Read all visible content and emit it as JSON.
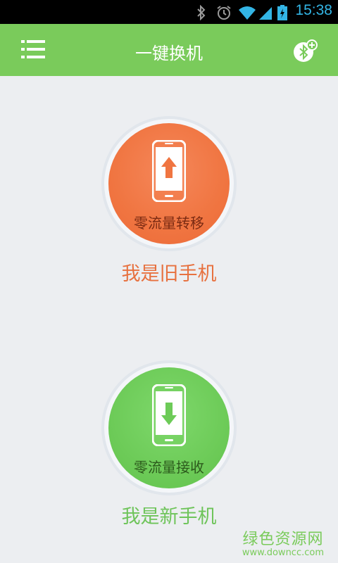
{
  "status_bar": {
    "time": "15:38",
    "icons": [
      "bluetooth-icon",
      "alarm-icon",
      "wifi-icon",
      "signal-icon",
      "battery-charging-icon"
    ]
  },
  "app_bar": {
    "title": "一键换机",
    "menu_icon": "menu-icon",
    "action_icon": "bluetooth-add-icon"
  },
  "old_phone": {
    "button_label": "零流量转移",
    "caption": "我是旧手机",
    "icon": "phone-upload-icon",
    "color": "#f07541"
  },
  "new_phone": {
    "button_label": "零流量接收",
    "caption": "我是新手机",
    "icon": "phone-download-icon",
    "color": "#6dcb58"
  },
  "watermark": {
    "main": "绿色资源网",
    "sub": "www.downcc.com"
  },
  "colors": {
    "app_bar": "#7acb5b",
    "status_bar": "#000000",
    "status_accent": "#33b5e5",
    "background": "#eceef1"
  }
}
